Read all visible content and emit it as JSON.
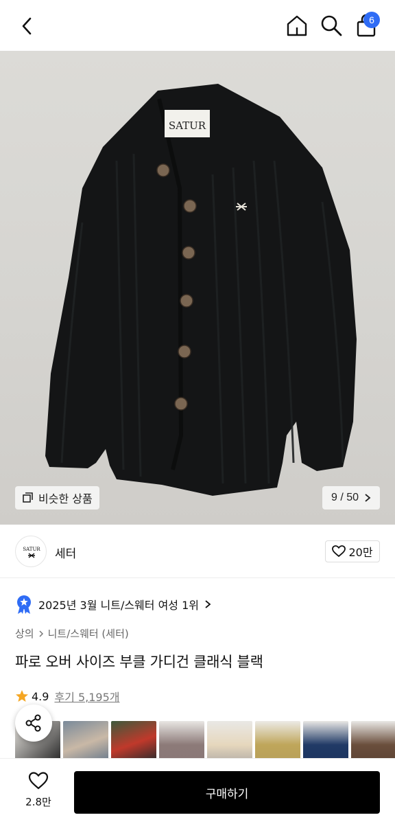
{
  "header": {
    "cart_count": "6"
  },
  "hero": {
    "similar_label": "비슷한 상품",
    "pager": "9 / 50",
    "label_text": "SATUR"
  },
  "brand": {
    "name": "세터",
    "logo_text": "SATUR",
    "likes": "20만"
  },
  "ranking": {
    "text": "2025년 3월 니트/스웨터 여성 1위"
  },
  "breadcrumb": {
    "level1": "상의",
    "level2": "니트/스웨터 (세터)"
  },
  "product": {
    "title": "파로 오버 사이즈 부클 가디건 클래식 블랙",
    "rating": "4.9",
    "review_label": "후기 5,195개"
  },
  "bottom_bar": {
    "wish_count": "2.8만",
    "buy_label": "구매하기"
  },
  "colors": {
    "accent_badge": "#2f6cf5",
    "buy_button": "#000000",
    "star": "#f5a623"
  }
}
